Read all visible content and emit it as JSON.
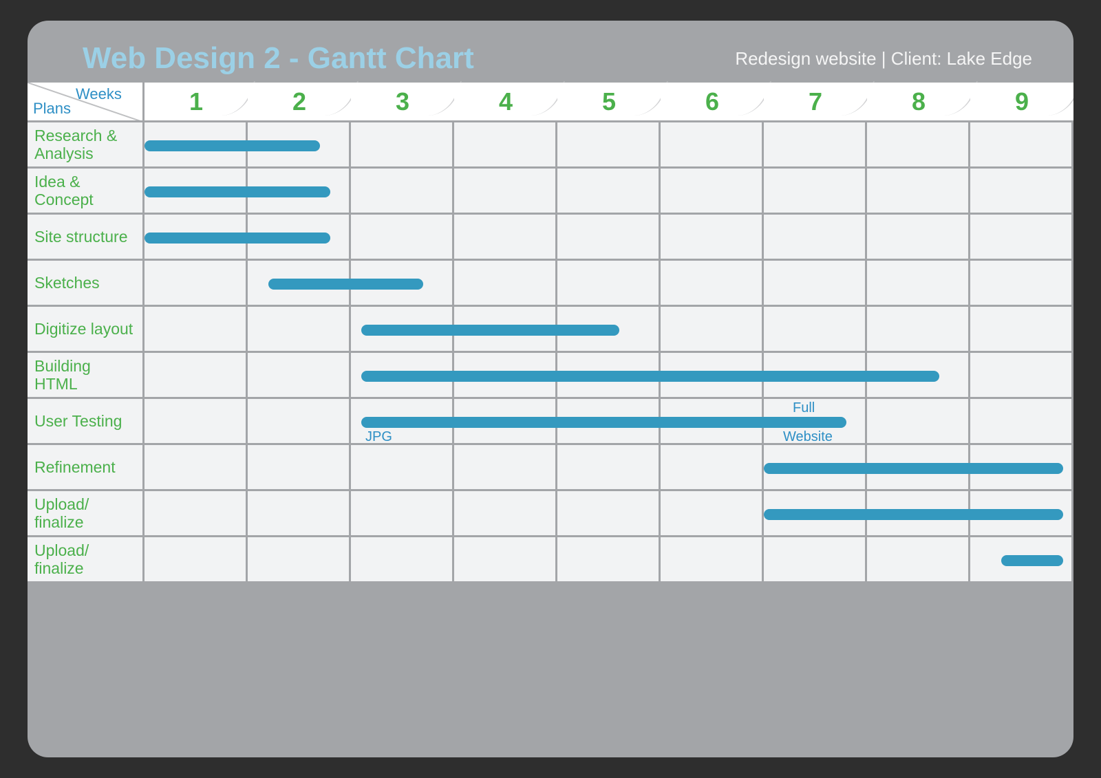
{
  "header": {
    "title": "Web Design 2 - Gantt Chart",
    "subtitle": "Redesign website | Client: Lake Edge"
  },
  "axis": {
    "columns_label": "Weeks",
    "rows_label": "Plans",
    "weeks": [
      "1",
      "2",
      "3",
      "4",
      "5",
      "6",
      "7",
      "8",
      "9"
    ]
  },
  "rows": [
    "Research & Analysis",
    "Idea & Concept",
    "Site structure",
    "Sketches",
    "Digitize layout",
    "Building HTML",
    "User Testing",
    "Refinement",
    "Upload/ finalize",
    "Upload/ finalize"
  ],
  "annotations": {
    "user_testing_start": "JPG",
    "user_testing_end_top": "Full",
    "user_testing_end_bottom": "Website"
  },
  "chart_data": {
    "type": "bar",
    "title": "Web Design 2 - Gantt Chart",
    "xlabel": "Weeks",
    "ylabel": "Plans",
    "categories": [
      "1",
      "2",
      "3",
      "4",
      "5",
      "6",
      "7",
      "8",
      "9"
    ],
    "tasks": [
      {
        "name": "Research & Analysis",
        "start": 1.0,
        "end": 2.7
      },
      {
        "name": "Idea & Concept",
        "start": 1.0,
        "end": 2.8
      },
      {
        "name": "Site structure",
        "start": 1.0,
        "end": 2.8
      },
      {
        "name": "Sketches",
        "start": 2.2,
        "end": 3.7
      },
      {
        "name": "Digitize layout",
        "start": 3.1,
        "end": 5.6
      },
      {
        "name": "Building HTML",
        "start": 3.1,
        "end": 8.7
      },
      {
        "name": "User Testing",
        "start": 3.1,
        "end": 7.8,
        "start_label": "JPG",
        "end_label": "Full Website"
      },
      {
        "name": "Refinement",
        "start": 7.0,
        "end": 9.9
      },
      {
        "name": "Upload/ finalize",
        "start": 7.0,
        "end": 9.9
      },
      {
        "name": "Upload/ finalize",
        "start": 9.3,
        "end": 9.9
      }
    ],
    "xlim": [
      0.5,
      9.5
    ]
  }
}
